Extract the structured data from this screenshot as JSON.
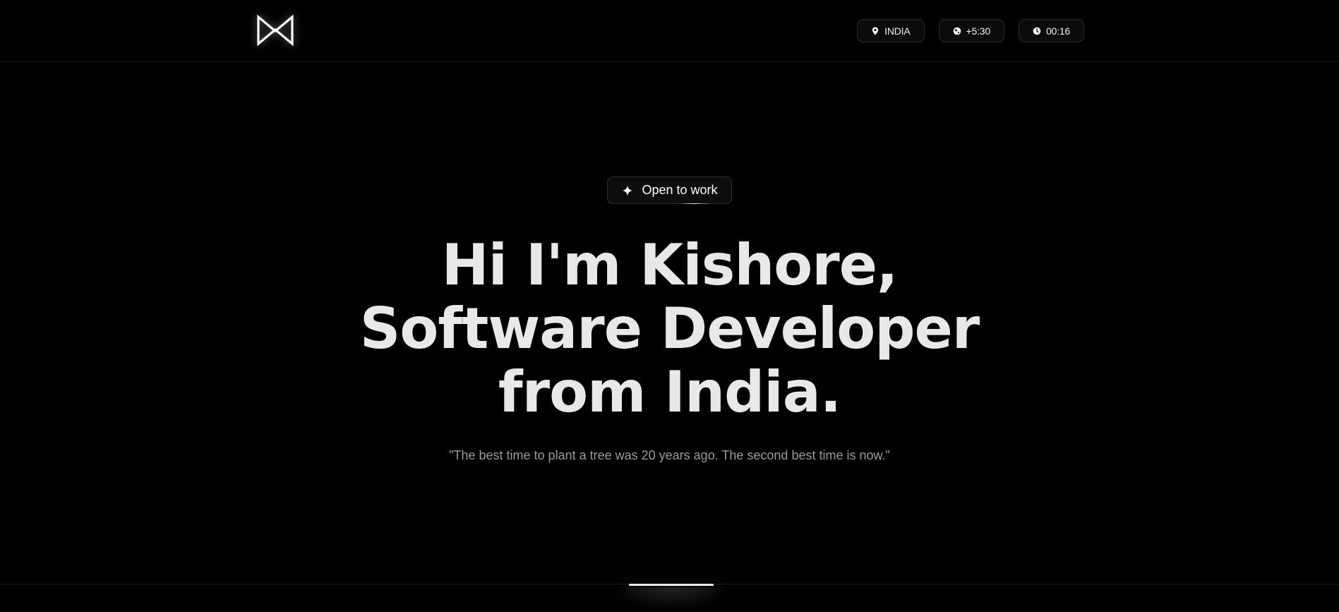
{
  "header": {
    "logo_icon": "mk-monogram-icon",
    "chips": [
      {
        "icon": "location-pin-icon",
        "label": "INDIA"
      },
      {
        "icon": "globe-icon",
        "label": "+5:30"
      },
      {
        "icon": "clock-icon",
        "label": "00:16"
      }
    ]
  },
  "hero": {
    "badge": {
      "icon": "sparkle-icon",
      "label": "Open to work"
    },
    "headline": {
      "line1": "Hi I'm Kishore,",
      "line2": "Software Developer",
      "line3": "from India."
    },
    "quote": "\"The best time to plant a tree was 20 years ago. The second best time is now.\""
  },
  "colors": {
    "background": "#000000",
    "text": "#e8e8e8",
    "muted": "#9a9a9a",
    "border": "#2a2a2a"
  }
}
